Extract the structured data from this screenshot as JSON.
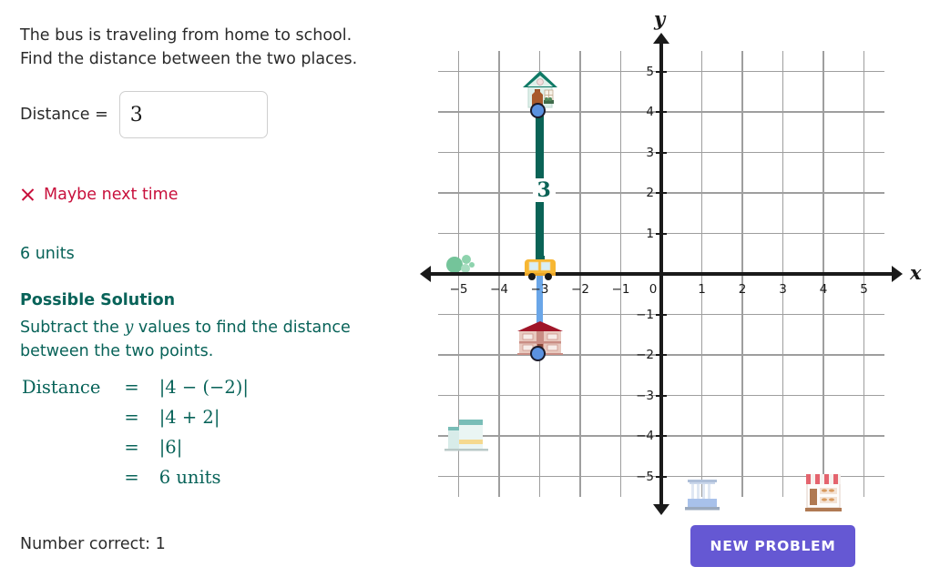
{
  "problem": {
    "line1": "The bus is traveling from home to school.",
    "line2": "Find the distance between the two places.",
    "distance_label": "Distance  =",
    "answer_value": "3",
    "answer_placeholder": ""
  },
  "feedback": {
    "icon": "x-mark-icon",
    "text": "Maybe next time",
    "color": "#c8103c",
    "correct_answer": "6 units"
  },
  "solution": {
    "title": "Possible Solution",
    "text_part1": "Subtract the",
    "text_var": "y",
    "text_part2": "values to find the distance",
    "text_line2": "between the two points.",
    "color": "#086359",
    "steps": [
      {
        "label": "Distance",
        "eq": "=",
        "value": "|4 − (−2)|"
      },
      {
        "label": "",
        "eq": "=",
        "value": "|4 + 2|"
      },
      {
        "label": "",
        "eq": "=",
        "value": "|6|"
      },
      {
        "label": "",
        "eq": "=",
        "value": "6 units"
      }
    ]
  },
  "footer": {
    "number_correct": "Number correct: 1",
    "new_problem_button": "NEW PROBLEM",
    "button_color": "#6558d3"
  },
  "chart_data": {
    "type": "scatter",
    "title": "",
    "xlabel": "x",
    "ylabel": "y",
    "xlim": [
      -5.5,
      5.5
    ],
    "ylim": [
      -5.5,
      5.5
    ],
    "grid": true,
    "x_ticks": [
      "−5",
      "−4",
      "−3",
      "−2",
      "−1",
      "0",
      "1",
      "2",
      "3",
      "4",
      "5"
    ],
    "y_ticks": [
      "5",
      "4",
      "3",
      "2",
      "1",
      "−1",
      "−2",
      "−3",
      "−4",
      "−5"
    ],
    "points": [
      {
        "name": "home",
        "x": -3,
        "y": 4,
        "icon": "house-icon",
        "label": ""
      },
      {
        "name": "school",
        "x": -3,
        "y": -2,
        "icon": "school-icon",
        "label": ""
      }
    ],
    "markers": [
      {
        "name": "bus",
        "x": -3,
        "y": 0,
        "icon": "school-bus-icon"
      }
    ],
    "segments": [
      {
        "name": "travelled-distance",
        "x": -3,
        "y_from": 4,
        "y_to": 0,
        "color": "#0a6356",
        "label": "3"
      },
      {
        "name": "remaining-distance",
        "x": -3,
        "y_from": 0,
        "y_to": -2,
        "color": "#6aa6e8",
        "label": ""
      }
    ],
    "decorations": [
      {
        "name": "bush-icon",
        "x": -5,
        "y": 0.35
      },
      {
        "name": "teal-building-icon",
        "x": -5,
        "y": -3.7
      },
      {
        "name": "civic-building-icon",
        "x": 1,
        "y": -4.55
      },
      {
        "name": "shop-icon",
        "x": 4,
        "y": -4.45
      }
    ]
  }
}
